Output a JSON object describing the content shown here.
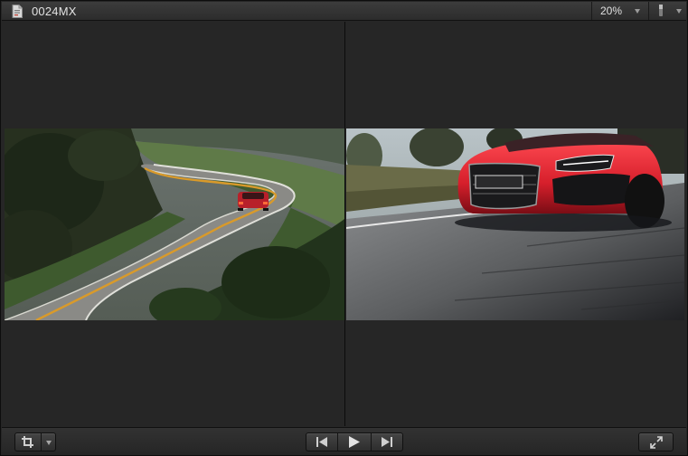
{
  "viewer": {
    "clip_name": "0024MX",
    "zoom_level": "20%"
  },
  "icons": {
    "document": "document-icon",
    "zoom_menu": "chevron-down-icon",
    "view_options": "view-options-icon",
    "transform": "crop-transform-icon",
    "go_to_start": "skip-back-icon",
    "play": "play-icon",
    "go_to_end": "skip-forward-icon",
    "fullscreen": "expand-fullscreen-icon"
  },
  "colors": {
    "background": "#262626",
    "titlebar": "#343434",
    "text": "#e2e2e2",
    "car_red": "#d8202a"
  }
}
